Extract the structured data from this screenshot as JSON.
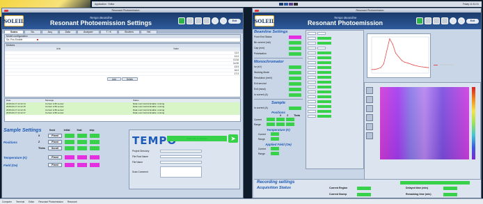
{
  "topbar": {
    "left": "Application · Editor",
    "clock": "Friday 11:31:31"
  },
  "left_window": {
    "title": "Resonant Photoemission",
    "banner_sub": "Tempo Beamline",
    "banner_main": "Resonant Photoemission Settings",
    "logo": "SOLEIL",
    "pill_label": "Exit",
    "tabs": [
      "Scans",
      "Sa.",
      "Acq",
      "Data",
      "Analyzer",
      "T / K",
      "Shutters",
      "Hel."
    ],
    "panel1_head": "Model configuration",
    "panel1_row": "Sa. Pos  Enable",
    "table_head": "Motions",
    "table_cols": [
      "Axis",
      "Value"
    ],
    "table_rows": [
      {
        "axis": "",
        "value": "11.0"
      },
      {
        "axis": "",
        "value": "12.0"
      },
      {
        "axis": "",
        "value": "13.34"
      },
      {
        "axis": "",
        "value": "14.00"
      },
      {
        "axis": "",
        "value": "13.5"
      },
      {
        "axis": "",
        "value": "16.0"
      },
      {
        "axis": "",
        "value": "17.0"
      }
    ],
    "btn_add": "Add",
    "btn_delete": "Delete",
    "log_header": [
      "Date",
      "Message",
      "Status"
    ],
    "log_rows": [
      {
        "date": "2015-02-17 11:12:14",
        "msg": "Current of Bi sensor",
        "status": "Data Lost Control Enable: running"
      },
      {
        "date": "2015-02-17 11:12:15",
        "msg": "Current of Bi sensor",
        "status": "Data Lost Control Enable: running"
      },
      {
        "date": "2015-02-17 11:12:16",
        "msg": "Current of Bi sensor",
        "status": "Data Lost Control Enable: running"
      },
      {
        "date": "2015-02-17 11:12:17",
        "msg": "Current of Bi sensor",
        "status": "Data Lost Control Enable: running"
      }
    ],
    "sample_settings": {
      "title": "Sample Settings",
      "cols": [
        "fixed",
        "initial",
        "final",
        "step"
      ],
      "positions_label": "Positions",
      "axes": [
        "X",
        "Z",
        "Theta"
      ],
      "fixed_label": "Fixed",
      "scroll_label": "Scroll",
      "temperature_label": "Temperature (K)",
      "field_label": "Field (Oe)"
    },
    "tempo": {
      "logo": "TEMPO",
      "status_text": "Start scan in progress",
      "form_labels": [
        "Project Directory",
        "File Root Name",
        "File Name",
        "Scan Comment"
      ]
    }
  },
  "right_window": {
    "title": "Resonant Photoemission",
    "banner_sub": "Tempo Beamline",
    "banner_main": "Resonant Photoemission",
    "logo": "SOLEIL",
    "pill_label": "Exit",
    "beamline_title": "Beamline Settings",
    "beamline_rows": [
      "Front End Status",
      "Be current (mA)",
      "Cap (mm)",
      "Polarization"
    ],
    "mono_title": "Monochromator",
    "mono_rows": [
      "hv (eV)",
      "Working Mode",
      "Resolution (meV)",
      "Exit second",
      "Exit (mrad)",
      "Io current (A)"
    ],
    "sample_title": "Sample",
    "sample_rows": [
      "Io current (A)"
    ],
    "positions_title": "Positions",
    "pos_cols": [
      "X",
      "Z",
      "Theta"
    ],
    "pos_rows": [
      "Current",
      "Range"
    ],
    "temp_title": "Temperature (K)",
    "temp_rows": [
      "Current",
      "Range"
    ],
    "field_title": "Applied Field (Oe)",
    "field_rows": [
      "Current",
      "Range"
    ],
    "recording_title": "Recording settings",
    "acq_title": "Acquisition Status",
    "acq_labels": [
      "Current Region",
      "Current Sweep",
      "Delayed time (min)",
      "Remaining time (min)"
    ]
  },
  "chart_data": [
    {
      "type": "line",
      "x": [
        0,
        1,
        2,
        3,
        4,
        5,
        6,
        7,
        8,
        9,
        10,
        11,
        12,
        13,
        14,
        15,
        16,
        17,
        18,
        19
      ],
      "series": [
        {
          "values": [
            0.1,
            0.1,
            0.12,
            0.15,
            0.25,
            0.6,
            0.95,
            0.8,
            0.55,
            0.45,
            0.35,
            0.3,
            0.28,
            0.25,
            0.22,
            0.2,
            0.18,
            0.17,
            0.16,
            0.15
          ]
        }
      ]
    }
  ],
  "colors": {
    "green": "#37d24a",
    "magenta": "#e62fe0",
    "navy": "#1b3a6b",
    "accent_blue": "#1b57b3"
  },
  "taskbar": {
    "items": [
      "Computer",
      "Terminal",
      "Editor",
      "Resonant Photoemission",
      "Resonant"
    ]
  }
}
